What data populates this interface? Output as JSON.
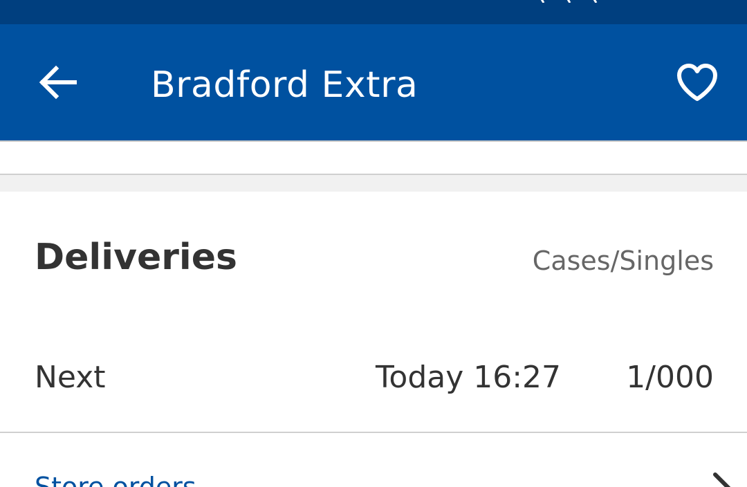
{
  "colors": {
    "status_bar": "#003f7f",
    "app_bar": "#0051a0",
    "title_text": "#ffffff",
    "body_text": "#333333",
    "muted_text": "#666666",
    "link_text": "#0051a0",
    "band": "#f1f1f1"
  },
  "app_bar": {
    "back_icon": "arrow-left-icon",
    "title": "Bradford Extra",
    "favorite_icon": "heart-outline-icon"
  },
  "deliveries": {
    "title": "Deliveries",
    "unit_label": "Cases/Singles",
    "rows": [
      {
        "label": "Next",
        "time": "Today 16:27",
        "count": "1/000"
      }
    ]
  },
  "store_orders": {
    "label": "Store orders",
    "chevron_icon": "chevron-right-icon"
  }
}
